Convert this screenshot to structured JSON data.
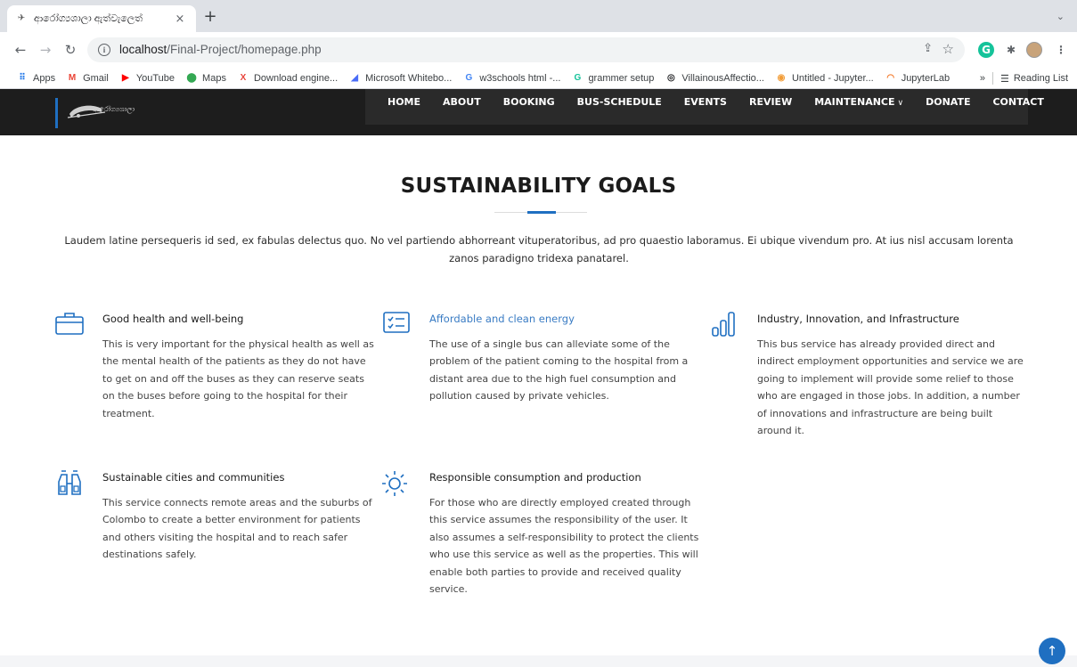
{
  "browser": {
    "tab_title": "ආරෝග්‍යශාලා ඇත්වැලෙත්",
    "tab_close": "×",
    "new_tab": "+",
    "url_host": "localhost",
    "url_path": "/Final-Project/homepage.php",
    "bookmarks": [
      {
        "label": "Apps",
        "icon": "apps-grid-icon",
        "color": "#1a73e8"
      },
      {
        "label": "Gmail",
        "icon": "gmail-icon",
        "color": "#ea4335"
      },
      {
        "label": "YouTube",
        "icon": "youtube-icon",
        "color": "#ff0000"
      },
      {
        "label": "Maps",
        "icon": "maps-pin-icon",
        "color": "#34a853"
      },
      {
        "label": "Download engine...",
        "icon": "x-icon",
        "color": "#e8453c"
      },
      {
        "label": "Microsoft Whitebo...",
        "icon": "whiteboard-icon",
        "color": "#4a6cf7"
      },
      {
        "label": "w3schools html -...",
        "icon": "google-g-icon",
        "color": "#4285f4"
      },
      {
        "label": "grammer setup",
        "icon": "grammarly-icon",
        "color": "#15c39a"
      },
      {
        "label": "VillainousAffectio...",
        "icon": "replit-icon",
        "color": "#202124"
      },
      {
        "label": "Untitled - Jupyter...",
        "icon": "jupyter-icon",
        "color": "#f29d38"
      },
      {
        "label": "JupyterLab",
        "icon": "jupyterlab-icon",
        "color": "#f37726"
      }
    ],
    "bookmarks_overflow": "»",
    "reading_list": "Reading List"
  },
  "site": {
    "logo_text": "ආරෝග්‍යශාලා",
    "nav": [
      {
        "label": "HOME"
      },
      {
        "label": "ABOUT"
      },
      {
        "label": "BOOKING"
      },
      {
        "label": "BUS-SCHEDULE"
      },
      {
        "label": "EVENTS"
      },
      {
        "label": "REVIEW"
      },
      {
        "label": "MAINTENANCE",
        "has_dropdown": true
      },
      {
        "label": "DONATE"
      },
      {
        "label": "CONTACT"
      }
    ]
  },
  "section": {
    "title": "SUSTAINABILITY GOALS",
    "intro": "Laudem latine persequeris id sed, ex fabulas delectus quo. No vel partiendo abhorreant vituperatoribus, ad pro quaestio laboramus. Ei ubique vivendum pro. At ius nisl accusam lorenta zanos paradigno tridexa panatarel."
  },
  "goals": [
    {
      "icon": "briefcase-icon",
      "title": "Good health and well-being",
      "desc": "This is very important for the physical health as well as the mental health of the patients as they do not have to get on and off the buses as they can reserve seats on the buses before going to the hospital for their treatment."
    },
    {
      "icon": "checklist-icon",
      "title": "Affordable and clean energy",
      "desc": "The use of a single bus can alleviate some of the problem of the patient coming to the hospital from a distant area due to the high fuel consumption and pollution caused by private vehicles."
    },
    {
      "icon": "bar-chart-icon",
      "title": "Industry, Innovation, and Infrastructure",
      "desc": "This bus service has already provided direct and indirect employment opportunities and service we are going to implement will provide some relief to those who are engaged in those jobs. In addition, a number of innovations and infrastructure are being built around it."
    },
    {
      "icon": "binoculars-icon",
      "title": "Sustainable cities and communities",
      "desc": "This service connects remote areas and the suburbs of Colombo to create a better environment for patients and others visiting the hospital and to reach safer destinations safely."
    },
    {
      "icon": "sun-icon",
      "title": "Responsible consumption and production",
      "desc": "For those who are directly employed created through this service assumes the responsibility of the user. It also assumes a self-responsibility to protect the clients who use this service as well as the properties. This will enable both parties to provide and received quality service."
    }
  ],
  "colors": {
    "accent": "#1f6fc1",
    "header_bg": "#1d1d1d",
    "link_title": "#3a7cc4"
  }
}
